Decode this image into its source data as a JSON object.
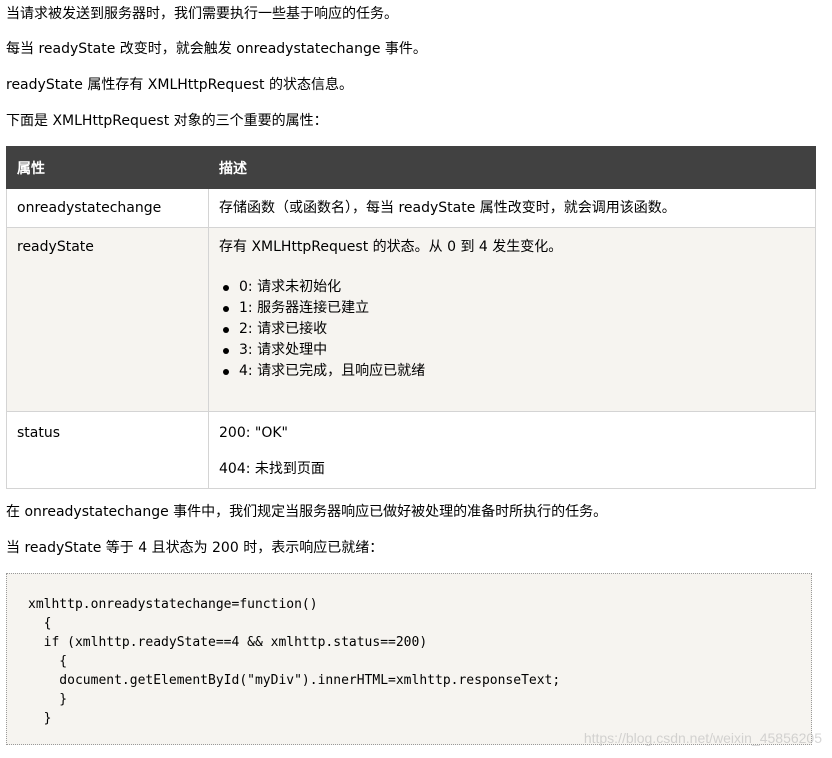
{
  "paragraphs": {
    "p1": "当请求被发送到服务器时，我们需要执行一些基于响应的任务。",
    "p2": "每当 readyState 改变时，就会触发 onreadystatechange 事件。",
    "p3": "readyState 属性存有 XMLHttpRequest 的状态信息。",
    "p4": "下面是 XMLHttpRequest 对象的三个重要的属性：",
    "p5": "在 onreadystatechange 事件中，我们规定当服务器响应已做好被处理的准备时所执行的任务。",
    "p6": "当 readyState 等于 4 且状态为 200 时，表示响应已就绪："
  },
  "table": {
    "headers": [
      "属性",
      "描述"
    ],
    "rows": [
      {
        "property": "onreadystatechange",
        "description": "存储函数（或函数名），每当 readyState 属性改变时，就会调用该函数。"
      },
      {
        "property": "readyState",
        "description": "存有 XMLHttpRequest 的状态。从 0 到 4 发生变化。",
        "states": [
          "0: 请求未初始化",
          "1: 服务器连接已建立",
          "2: 请求已接收",
          "3: 请求处理中",
          "4: 请求已完成，且响应已就绪"
        ]
      },
      {
        "property": "status",
        "lines": [
          "200: \"OK\"",
          "404: 未找到页面"
        ]
      }
    ]
  },
  "code": "xmlhttp.onreadystatechange=function()\n  {\n  if (xmlhttp.readyState==4 && xmlhttp.status==200)\n    {\n    document.getElementById(\"myDiv\").innerHTML=xmlhttp.responseText;\n    }\n  }",
  "watermark": "https://blog.csdn.net/weixin_45856205"
}
